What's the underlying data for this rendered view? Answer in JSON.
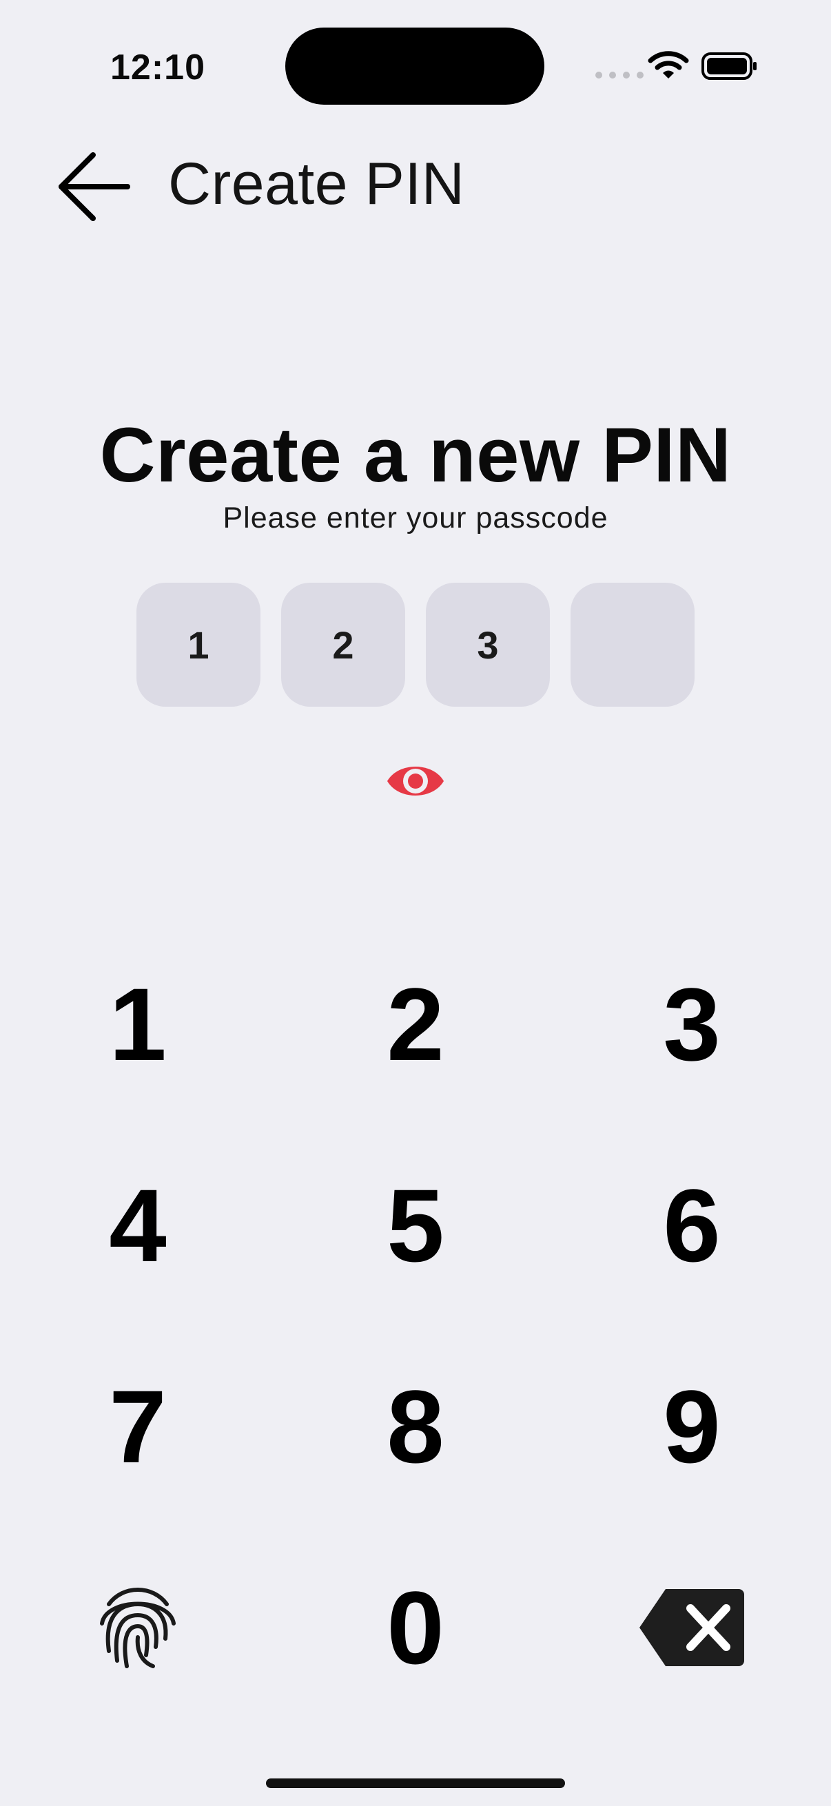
{
  "status_bar": {
    "time": "12:10",
    "icons": [
      "cellular-dots-icon",
      "wifi-icon",
      "battery-icon"
    ]
  },
  "header": {
    "back_icon": "arrow-left-icon",
    "title": "Create PIN"
  },
  "main": {
    "title": "Create a new PIN",
    "subtitle": "Please enter your passcode"
  },
  "pin": {
    "digits": [
      "1",
      "2",
      "3",
      ""
    ],
    "visibility_icon": "eye-icon",
    "visibility_icon_color": "#e63946"
  },
  "keypad": {
    "keys": [
      "1",
      "2",
      "3",
      "4",
      "5",
      "6",
      "7",
      "8",
      "9",
      "0"
    ],
    "fingerprint_icon": "fingerprint-icon",
    "delete_icon": "backspace-icon"
  },
  "colors": {
    "background": "#efeff4",
    "pin_box": "#dcdbe5",
    "accent": "#e63946"
  }
}
